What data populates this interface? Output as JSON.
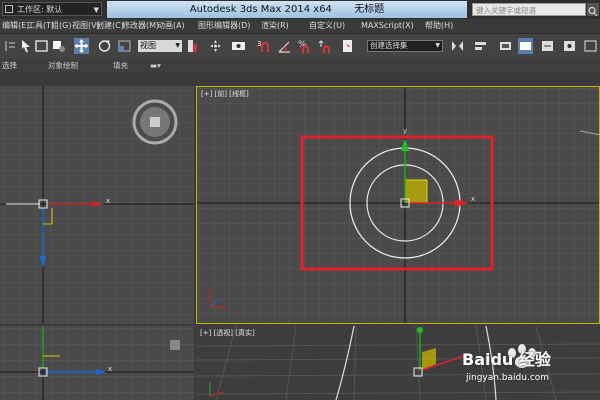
{
  "titlebar": {
    "workspace": "工作区: 默认",
    "app_title": "Autodesk 3ds Max  2014 x64",
    "doc_title": "无标题",
    "search_placeholder": "键入关键字或短语"
  },
  "menu": [
    "编辑(E)",
    "工具(T)",
    "组(G)",
    "视图(V)",
    "创建(C)",
    "修改器(M)",
    "动画(A)",
    "图形编辑器(D)",
    "渲染(R)",
    "自定义(U)",
    "MAXScript(X)",
    "帮助(H)"
  ],
  "toolbar": {
    "reference_coord": "视图",
    "selection_set": "创建选择集",
    "percent_snap": "%",
    "angle_snap": "n"
  },
  "ribbon": [
    "选择",
    "对象绘制",
    "填充"
  ],
  "viewports": {
    "perspective_label": "[+] [前] [线框]",
    "bottom_right_label": "[+] [透视] [真实]",
    "axis_x": "x",
    "axis_y": "y"
  },
  "watermark": {
    "brand": "Baidu 经验",
    "url": "jingyan.baidu.com"
  },
  "colors": {
    "accent_highlight": "#e0202a",
    "grid_line": "#5a5a5a",
    "viewport_bg": "#4a4a4a",
    "active_border": "#e8c800"
  }
}
